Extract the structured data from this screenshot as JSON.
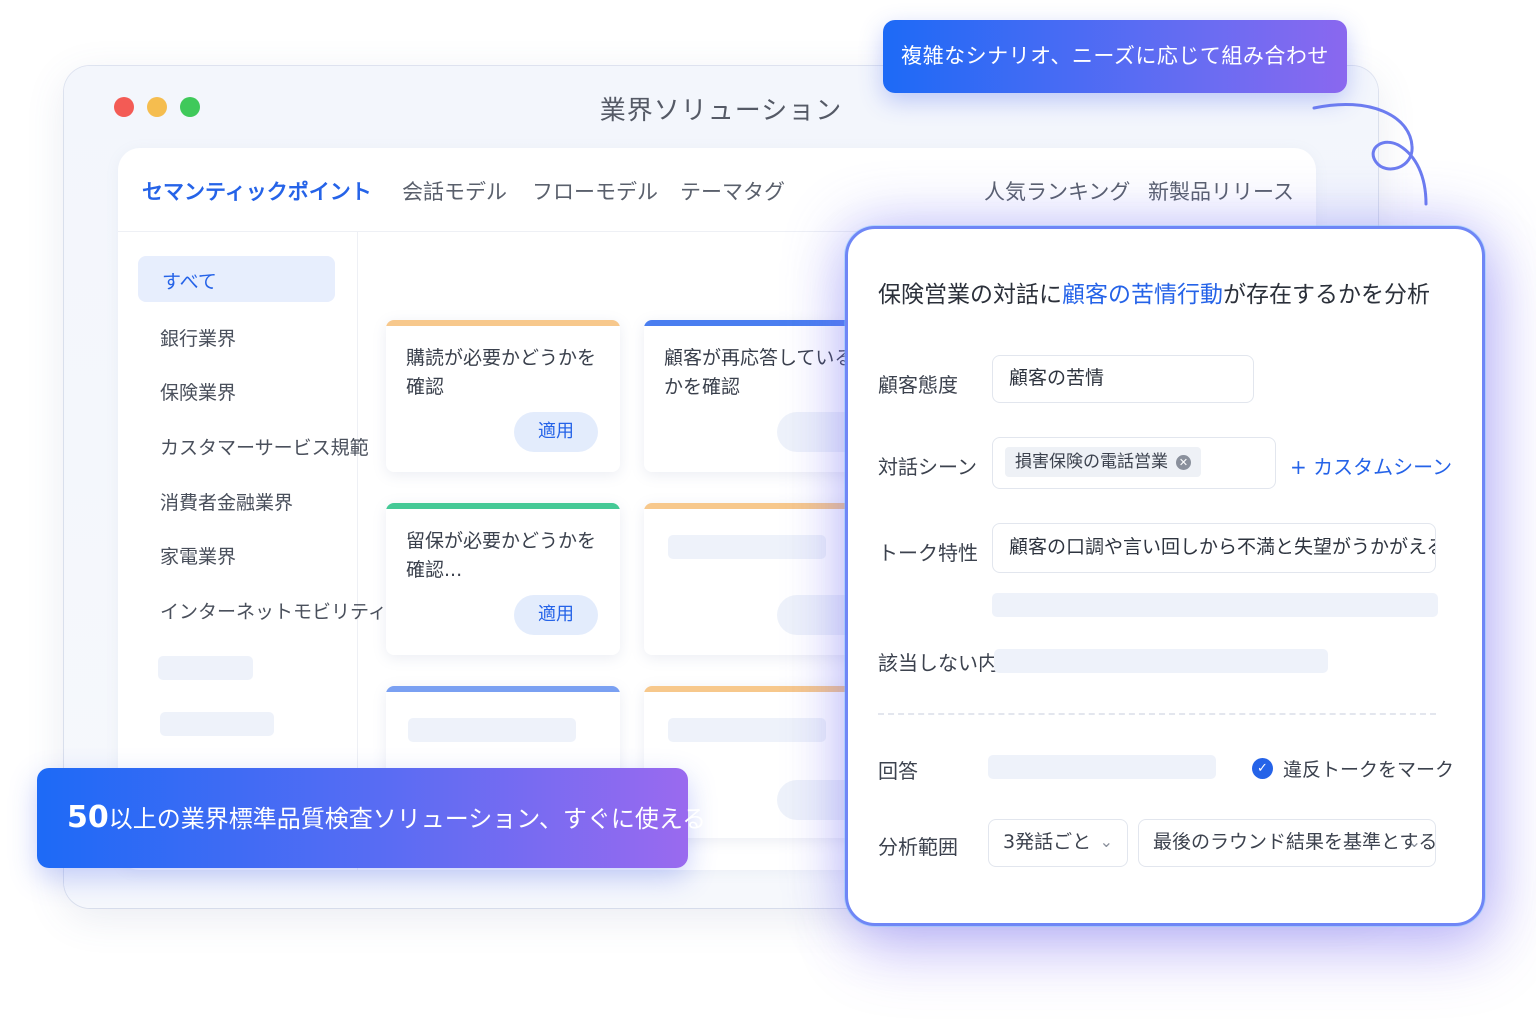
{
  "window": {
    "title": "業界ソリューション"
  },
  "tabs": {
    "left": [
      "セマンティックポイント",
      "会話モデル",
      "フローモデル",
      "テーマタグ"
    ],
    "right": [
      "人気ランキング",
      "新製品リリース"
    ]
  },
  "sidebar": {
    "active": "すべて",
    "items": [
      "銀行業界",
      "保険業界",
      "カスタマーサービス規範",
      "消費者金融業界",
      "家電業界",
      "インターネットモビリティ"
    ]
  },
  "cards": [
    {
      "text": "購読が必要かどうかを確認",
      "button": "適用",
      "accent": "#f7c88c"
    },
    {
      "text": "顧客が再応答しているかを確認",
      "accent": "#4a7ef0"
    },
    {
      "text": "留保が必要かどうかを確認...",
      "button": "適用",
      "accent": "#45c996"
    }
  ],
  "banners": {
    "top": "複雑なシナリオ、ニーズに応じて組み合わせ",
    "bottom_number": "50",
    "bottom_text": "以上の業界標準品質検査ソリューション、すぐに使える"
  },
  "form": {
    "title_prefix": "保険営業の対話に",
    "title_highlight": "顧客の苦情行動",
    "title_suffix": "が存在するかを分析",
    "attitude_label": "顧客態度",
    "attitude_value": "顧客の苦情",
    "scene_label": "対話シーン",
    "scene_chip": "損害保険の電話営業",
    "custom_scene": "+ カスタムシーン",
    "talk_label": "トーク特性",
    "talk_value": "顧客の口調や言い回しから不満と失望がうかがえる",
    "exclude_label": "該当しない内容",
    "answer_label": "回答",
    "mark_label": "違反トークをマーク",
    "range_label": "分析範囲",
    "range_select1": "3発話ごと",
    "range_select2": "最後のラウンド結果を基準とする"
  },
  "colors": {
    "accent": "#2563e8",
    "banner_start": "#1d6af6",
    "banner_end": "#8a68ef"
  }
}
